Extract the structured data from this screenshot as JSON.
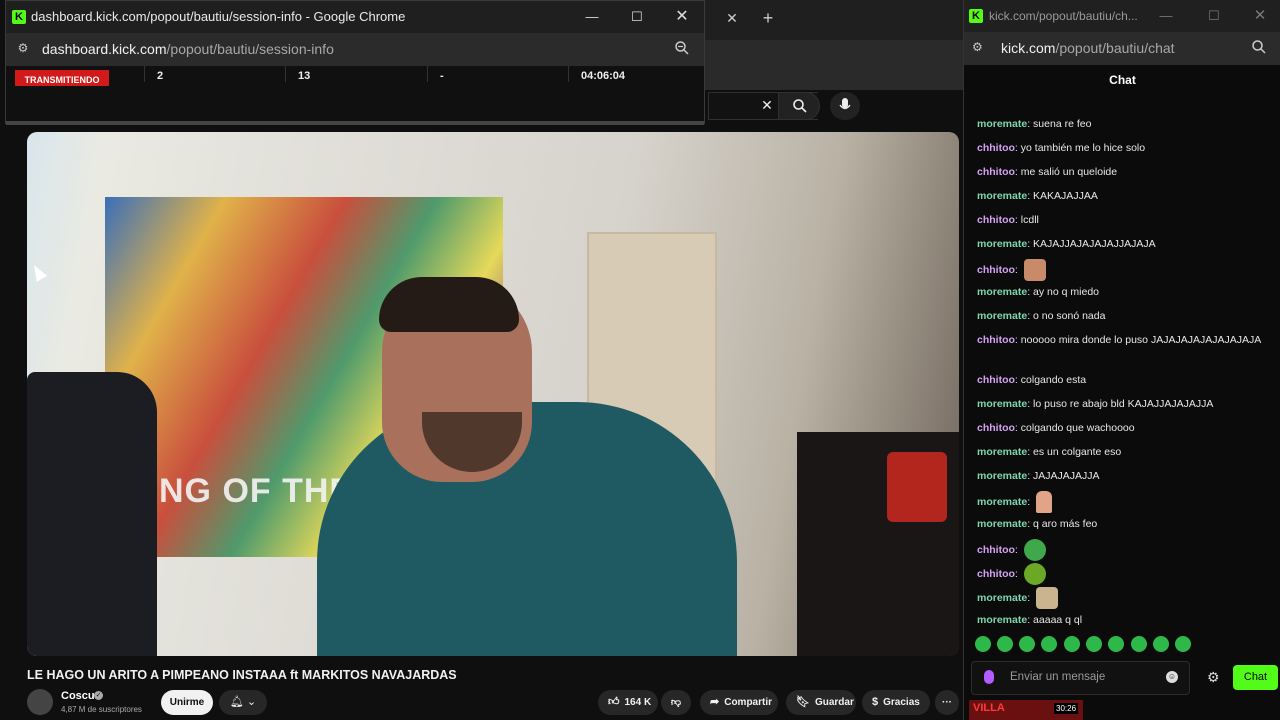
{
  "popup_session": {
    "title": "dashboard.kick.com/popout/bautiu/session-info - Google Chrome",
    "url_host": "dashboard.kick.com",
    "url_path": "/popout/bautiu/session-info",
    "status": "TRANSMITIENDO",
    "stats": [
      "2",
      "13",
      "-",
      "04:06:04"
    ]
  },
  "background_page": {
    "video_title": "LE HAGO UN ARITO A PIMPEANO INSTAAA ft MARKITOS NAVAJARDAS",
    "video_overlay_text": "KING OF THE",
    "channel_name": "Coscu",
    "subscribers": "4,87 M de suscriptores",
    "join_label": "Unirme",
    "like_count": "164 K",
    "share_label": "Compartir",
    "save_label": "Guardar",
    "thanks_label": "Gracias",
    "more_label": "···"
  },
  "chat_window": {
    "title": "kick.com/popout/bautiu/ch...",
    "url_host": "kick.com",
    "url_path": "/popout/bautiu/chat",
    "header": "Chat",
    "input_placeholder": "Enviar un mensaje",
    "send_label": "Chat",
    "messages": [
      {
        "user": "moremate",
        "text": "suena re feo",
        "color": "#7fd6b0"
      },
      {
        "user": "chhitoo",
        "text": "yo también me lo hice solo",
        "color": "#d3a3f5"
      },
      {
        "user": "chhitoo",
        "text": "me salió un queloide",
        "color": "#d3a3f5"
      },
      {
        "user": "moremate",
        "text": "KAKAJAJJAA",
        "color": "#7fd6b0"
      },
      {
        "user": "chhitoo",
        "text": "lcdll",
        "color": "#d3a3f5"
      },
      {
        "user": "moremate",
        "text": "KAJAJJAJAJAJAJJAJAJA",
        "color": "#7fd6b0"
      },
      {
        "user": "chhitoo",
        "text": "",
        "emote": "face-emote",
        "color": "#d3a3f5"
      },
      {
        "user": "moremate",
        "text": "ay no q miedo",
        "color": "#7fd6b0"
      },
      {
        "user": "moremate",
        "text": "o no sonó nada",
        "color": "#7fd6b0"
      },
      {
        "user": "chhitoo",
        "text": "nooooo mira donde lo puso JAJAJAJAJAJAJAJAJA",
        "color": "#d3a3f5"
      },
      {
        "user": "chhitoo",
        "text": "colgando esta",
        "color": "#d3a3f5"
      },
      {
        "user": "moremate",
        "text": "lo puso re abajo bld KAJAJJAJAJAJJA",
        "color": "#7fd6b0"
      },
      {
        "user": "chhitoo",
        "text": "colgando que wachoooo",
        "color": "#d3a3f5"
      },
      {
        "user": "moremate",
        "text": "es un colgante eso",
        "color": "#7fd6b0"
      },
      {
        "user": "moremate",
        "text": "JAJAJAJAJJA",
        "color": "#7fd6b0"
      },
      {
        "user": "moremate",
        "text": "",
        "emote": "hand-emote",
        "color": "#7fd6b0"
      },
      {
        "user": "moremate",
        "text": "q aro más feo",
        "color": "#7fd6b0"
      },
      {
        "user": "chhitoo",
        "text": "",
        "emote": "frog-emote",
        "color": "#d3a3f5"
      },
      {
        "user": "chhitoo",
        "text": "",
        "emote": "frog2-emote",
        "color": "#d3a3f5"
      },
      {
        "user": "moremate",
        "text": "",
        "emote": "box-emote",
        "color": "#7fd6b0"
      },
      {
        "user": "moremate",
        "text": "aaaaa q ql",
        "color": "#7fd6b0"
      }
    ]
  },
  "mini_thumbnail": {
    "text": "VILLA",
    "time": "30:26"
  },
  "colors": {
    "kick_green": "#53fc18",
    "live_red": "#d21a1a"
  }
}
